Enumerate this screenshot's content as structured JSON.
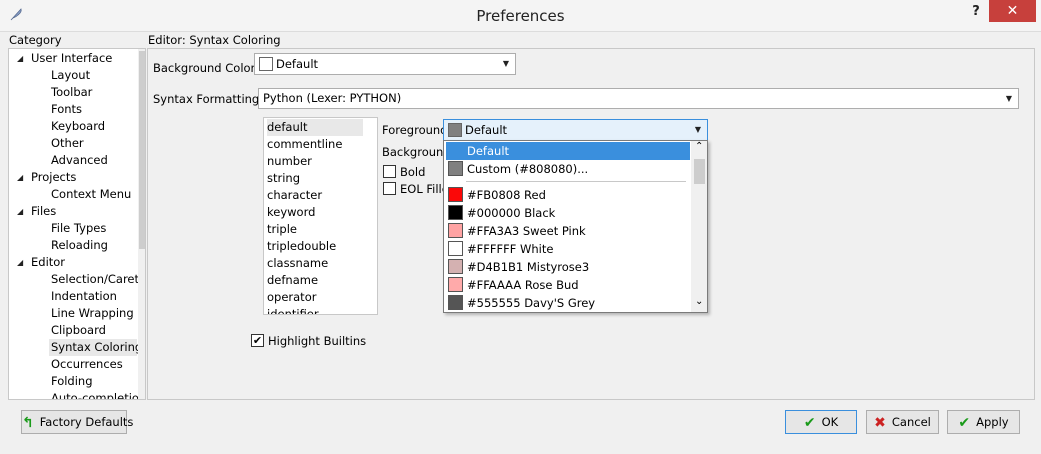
{
  "window": {
    "title": "Preferences",
    "help": "?",
    "close": "✕"
  },
  "category": {
    "label": "Category",
    "items": [
      {
        "label": "User Interface",
        "level": 0,
        "expander": "◢"
      },
      {
        "label": "Layout",
        "level": 1
      },
      {
        "label": "Toolbar",
        "level": 1
      },
      {
        "label": "Fonts",
        "level": 1
      },
      {
        "label": "Keyboard",
        "level": 1
      },
      {
        "label": "Other",
        "level": 1
      },
      {
        "label": "Advanced",
        "level": 1
      },
      {
        "label": "Projects",
        "level": 0,
        "expander": "◢"
      },
      {
        "label": "Context Menu",
        "level": 1
      },
      {
        "label": "Files",
        "level": 0,
        "expander": "◢"
      },
      {
        "label": "File Types",
        "level": 1
      },
      {
        "label": "Reloading",
        "level": 1
      },
      {
        "label": "Editor",
        "level": 0,
        "expander": "◢"
      },
      {
        "label": "Selection/Caret",
        "level": 1
      },
      {
        "label": "Indentation",
        "level": 1
      },
      {
        "label": "Line Wrapping",
        "level": 1
      },
      {
        "label": "Clipboard",
        "level": 1
      },
      {
        "label": "Syntax Coloring",
        "level": 1,
        "selected": true
      },
      {
        "label": "Occurrences",
        "level": 1
      },
      {
        "label": "Folding",
        "level": 1
      },
      {
        "label": "Auto-completion",
        "level": 1
      }
    ]
  },
  "panel": {
    "title": "Editor: Syntax Coloring",
    "background_color_label": "Background Color",
    "background_color_value": "Default",
    "syntax_formatting_label": "Syntax Formatting",
    "syntax_formatting_value": "Python (Lexer: PYTHON)",
    "styles": [
      "default",
      "commentline",
      "number",
      "string",
      "character",
      "keyword",
      "triple",
      "tripledouble",
      "classname",
      "defname",
      "operator",
      "identifier"
    ],
    "foreground_label": "Foreground",
    "foreground_value": "Default",
    "foreground_swatch": "#808080",
    "background_label": "Background",
    "bold_label": "Bold",
    "eol_filled_label": "EOL Filled",
    "highlight_builtins_label": "Highlight Builtins",
    "highlight_builtins_checked": "✔"
  },
  "dropdown": {
    "items": [
      {
        "label": "Default",
        "color": "",
        "selected": true
      },
      {
        "label": "Custom (#808080)...",
        "color": "#808080"
      },
      {
        "label": "#FB0808 Red",
        "color": "#FB0808"
      },
      {
        "label": "#000000 Black",
        "color": "#000000"
      },
      {
        "label": "#FFA3A3 Sweet Pink",
        "color": "#FFA3A3"
      },
      {
        "label": "#FFFFFF White",
        "color": "#FFFFFF"
      },
      {
        "label": "#D4B1B1 Mistyrose3",
        "color": "#D4B1B1"
      },
      {
        "label": "#FFAAAA Rose Bud",
        "color": "#FFAAAA"
      },
      {
        "label": "#555555 Davy'S Grey",
        "color": "#555555"
      }
    ]
  },
  "buttons": {
    "factory_defaults": "Factory Defaults",
    "ok": "OK",
    "cancel": "Cancel",
    "apply": "Apply"
  },
  "colors": {
    "ok_check": "#1a9a1a",
    "cancel_x": "#cc2222",
    "accent": "#3a8fdd"
  }
}
